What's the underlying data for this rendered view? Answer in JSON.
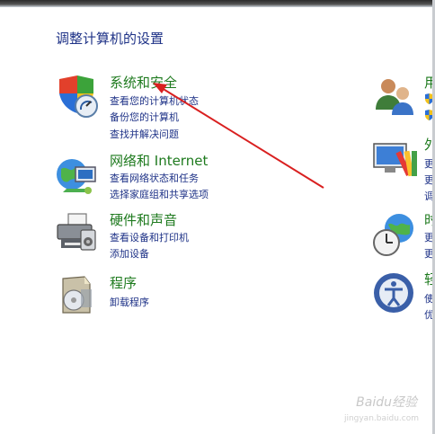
{
  "page_title": "调整计算机的设置",
  "categories": [
    {
      "title": "系统和安全",
      "links": [
        "查看您的计算机状态",
        "备份您的计算机",
        "查找并解决问题"
      ]
    },
    {
      "title": "网络和 Internet",
      "links": [
        "查看网络状态和任务",
        "选择家庭组和共享选项"
      ]
    },
    {
      "title": "硬件和声音",
      "links": [
        "查看设备和打印机",
        "添加设备"
      ]
    },
    {
      "title": "程序",
      "links": [
        "卸载程序"
      ]
    }
  ],
  "right_categories": [
    {
      "title": "用",
      "lines": [
        "",
        ""
      ]
    },
    {
      "title": "外",
      "lines": [
        "更",
        "更",
        "调"
      ]
    },
    {
      "title": "时",
      "lines": [
        "更",
        "更"
      ]
    },
    {
      "title": "轻",
      "lines": [
        "使",
        "优"
      ]
    }
  ],
  "watermark": {
    "brand": "Baidu经验",
    "url": "jingyan.baidu.com"
  },
  "colors": {
    "category_title": "#1e7a1e",
    "link": "#1e3287",
    "arrow": "#d92020"
  }
}
